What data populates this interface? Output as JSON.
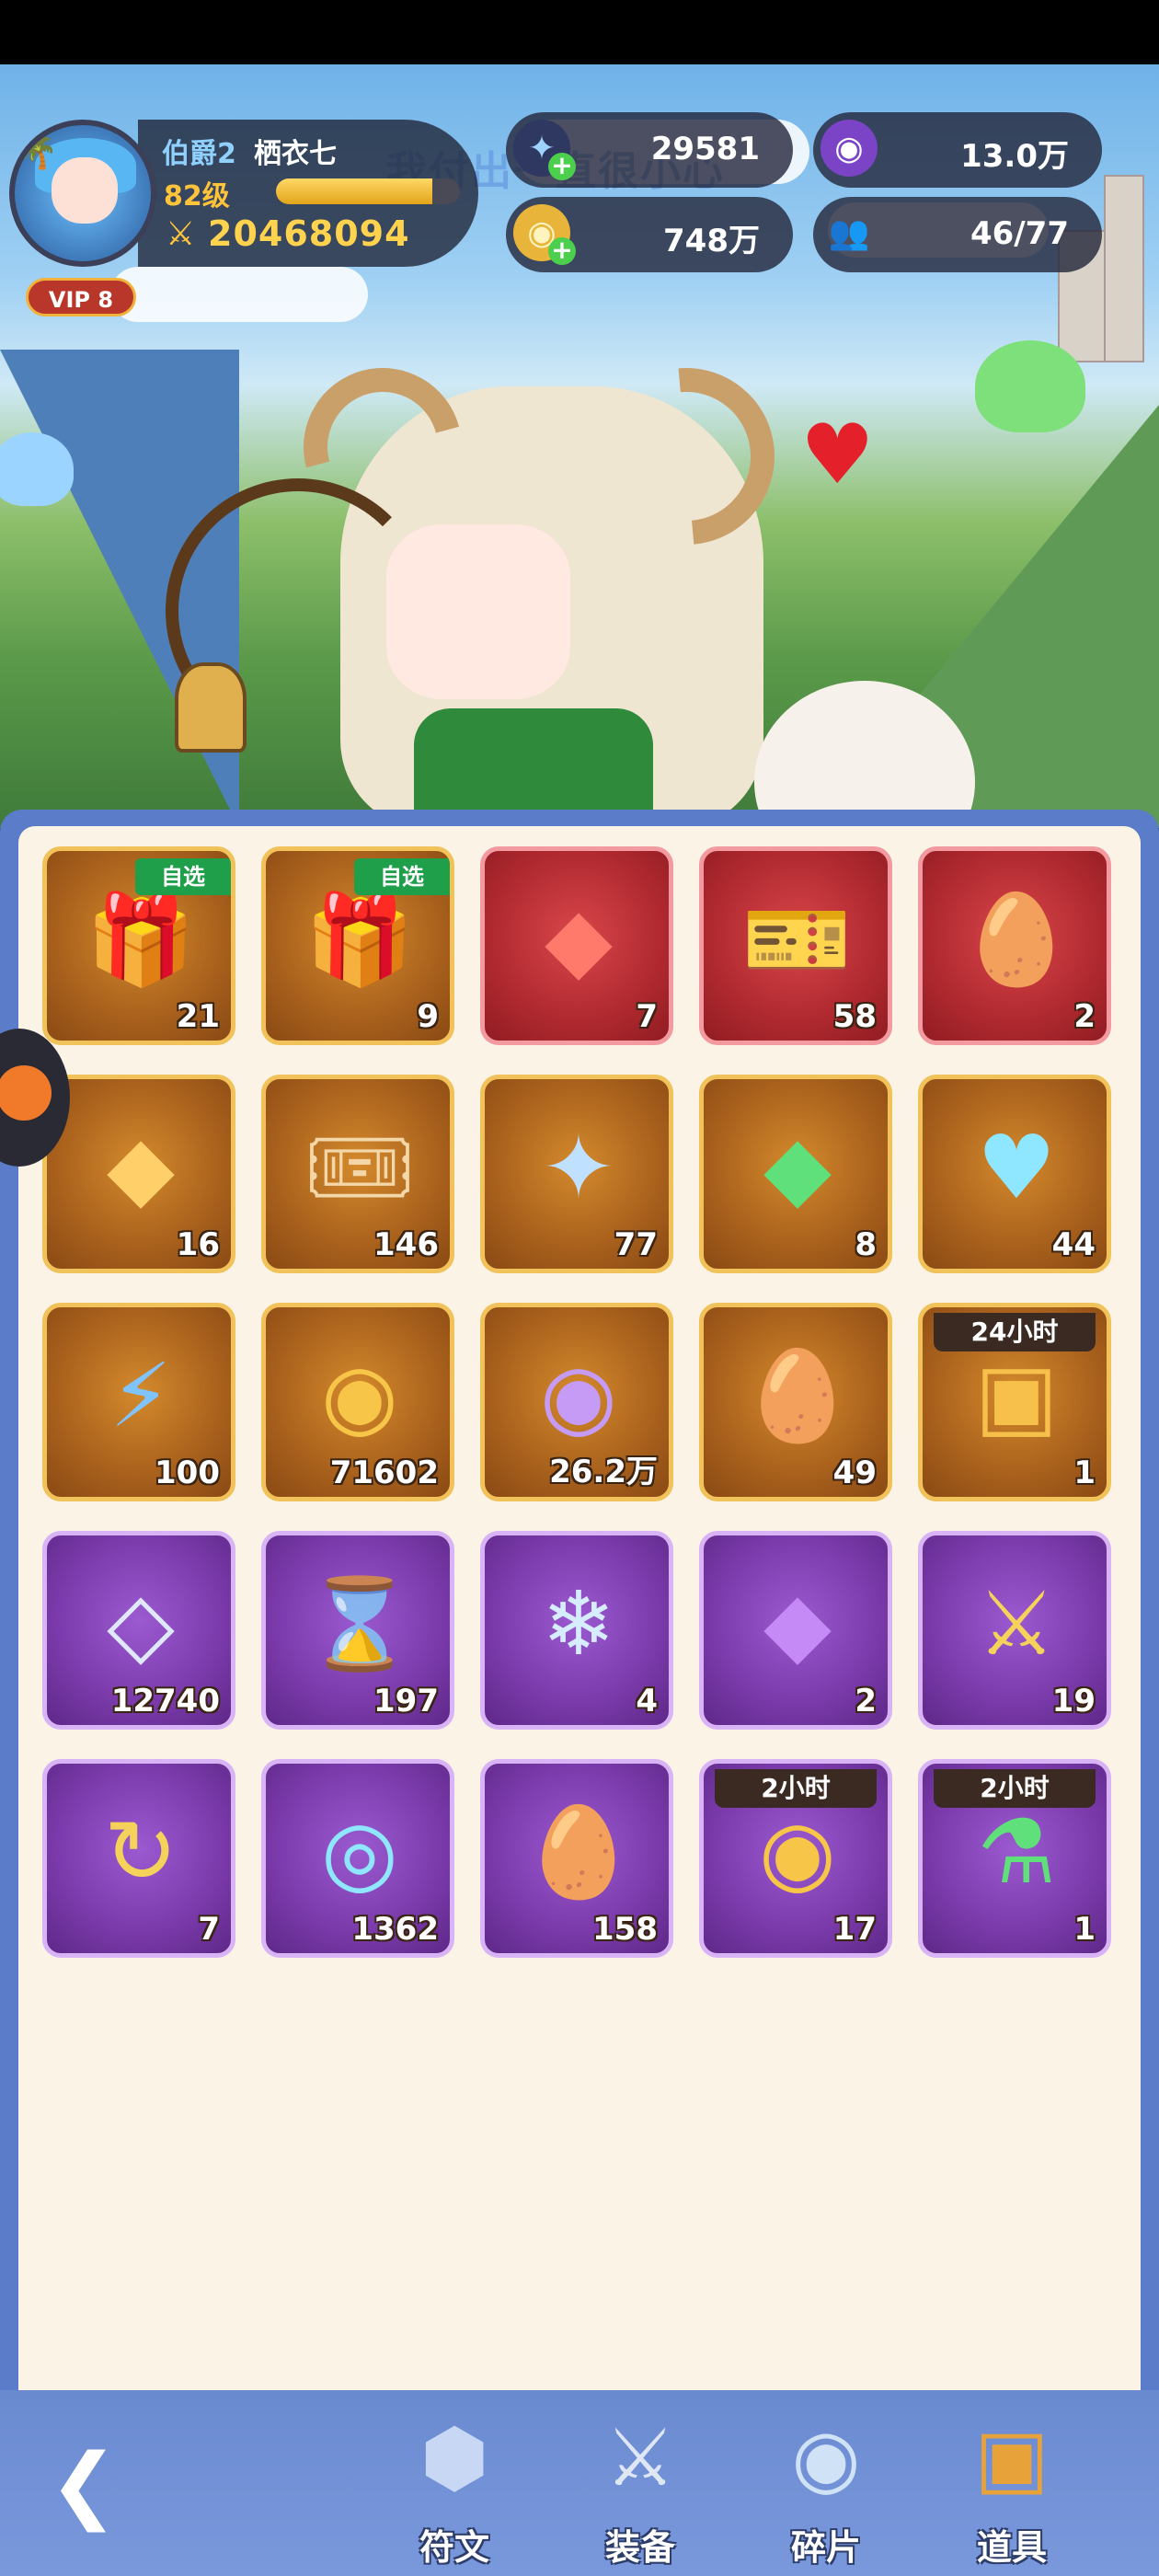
{
  "player": {
    "rank": "伯爵2",
    "name": "栖衣七",
    "level": "82级",
    "level_progress": 0.85,
    "power": "20468094",
    "vip": "VIP 8"
  },
  "currencies": [
    {
      "icon": "star-crystal-icon",
      "value": "29581",
      "has_plus": true
    },
    {
      "icon": "purple-coin-icon",
      "value": "13.0万",
      "has_plus": false
    },
    {
      "icon": "gold-coin-icon",
      "value": "748万",
      "has_plus": true
    },
    {
      "icon": "friends-icon",
      "value": "46/77",
      "has_plus": false
    }
  ],
  "scroll_banner": "我付出一直很小心",
  "items": [
    {
      "icon": "gift-box-icon",
      "count": "21",
      "rarity": "gold",
      "tag": "自选"
    },
    {
      "icon": "gift-box-icon",
      "count": "9",
      "rarity": "gold",
      "tag": "自选"
    },
    {
      "icon": "red-rune-crystal-icon",
      "count": "7",
      "rarity": "red"
    },
    {
      "icon": "golden-ticket-icon",
      "count": "58",
      "rarity": "red"
    },
    {
      "icon": "fire-egg-icon",
      "count": "2",
      "rarity": "red"
    },
    {
      "icon": "amber-rune-crystal-icon",
      "count": "16",
      "rarity": "gold"
    },
    {
      "icon": "summon-ticket-icon",
      "count": "146",
      "rarity": "gold"
    },
    {
      "icon": "blue-star-crystal-icon",
      "count": "77",
      "rarity": "gold"
    },
    {
      "icon": "green-gem-icon",
      "count": "8",
      "rarity": "gold"
    },
    {
      "icon": "heart-card-icon",
      "count": "44",
      "rarity": "gold"
    },
    {
      "icon": "lightning-potion-icon",
      "count": "100",
      "rarity": "gold"
    },
    {
      "icon": "gold-medal-icon",
      "count": "71602",
      "rarity": "gold"
    },
    {
      "icon": "purple-medal-icon",
      "count": "26.2万",
      "rarity": "gold"
    },
    {
      "icon": "dragon-egg-icon",
      "count": "49",
      "rarity": "gold"
    },
    {
      "icon": "treasure-chest-icon",
      "count": "1",
      "rarity": "gold",
      "timer": "24小时"
    },
    {
      "icon": "diamond-icon",
      "count": "12740",
      "rarity": "purple"
    },
    {
      "icon": "hourglass-icon",
      "count": "197",
      "rarity": "purple"
    },
    {
      "icon": "ice-crystal-icon",
      "count": "4",
      "rarity": "purple"
    },
    {
      "icon": "purple-rune-crystal-icon",
      "count": "2",
      "rarity": "purple"
    },
    {
      "icon": "sword-card-icon",
      "count": "19",
      "rarity": "purple"
    },
    {
      "icon": "refresh-card-icon",
      "count": "7",
      "rarity": "purple"
    },
    {
      "icon": "crystal-orb-icon",
      "count": "1362",
      "rarity": "purple"
    },
    {
      "icon": "purple-egg-icon",
      "count": "158",
      "rarity": "purple"
    },
    {
      "icon": "coin-stack-icon",
      "count": "17",
      "rarity": "purple",
      "timer": "2小时"
    },
    {
      "icon": "green-potion-icon",
      "count": "1",
      "rarity": "purple",
      "timer": "2小时"
    }
  ],
  "nav": [
    {
      "icon": "rune-icon",
      "label": "符文"
    },
    {
      "icon": "crossed-swords-icon",
      "label": "装备"
    },
    {
      "icon": "puzzle-piece-icon",
      "label": "碎片"
    },
    {
      "icon": "treasure-chest-icon",
      "label": "道具",
      "active": true
    }
  ]
}
